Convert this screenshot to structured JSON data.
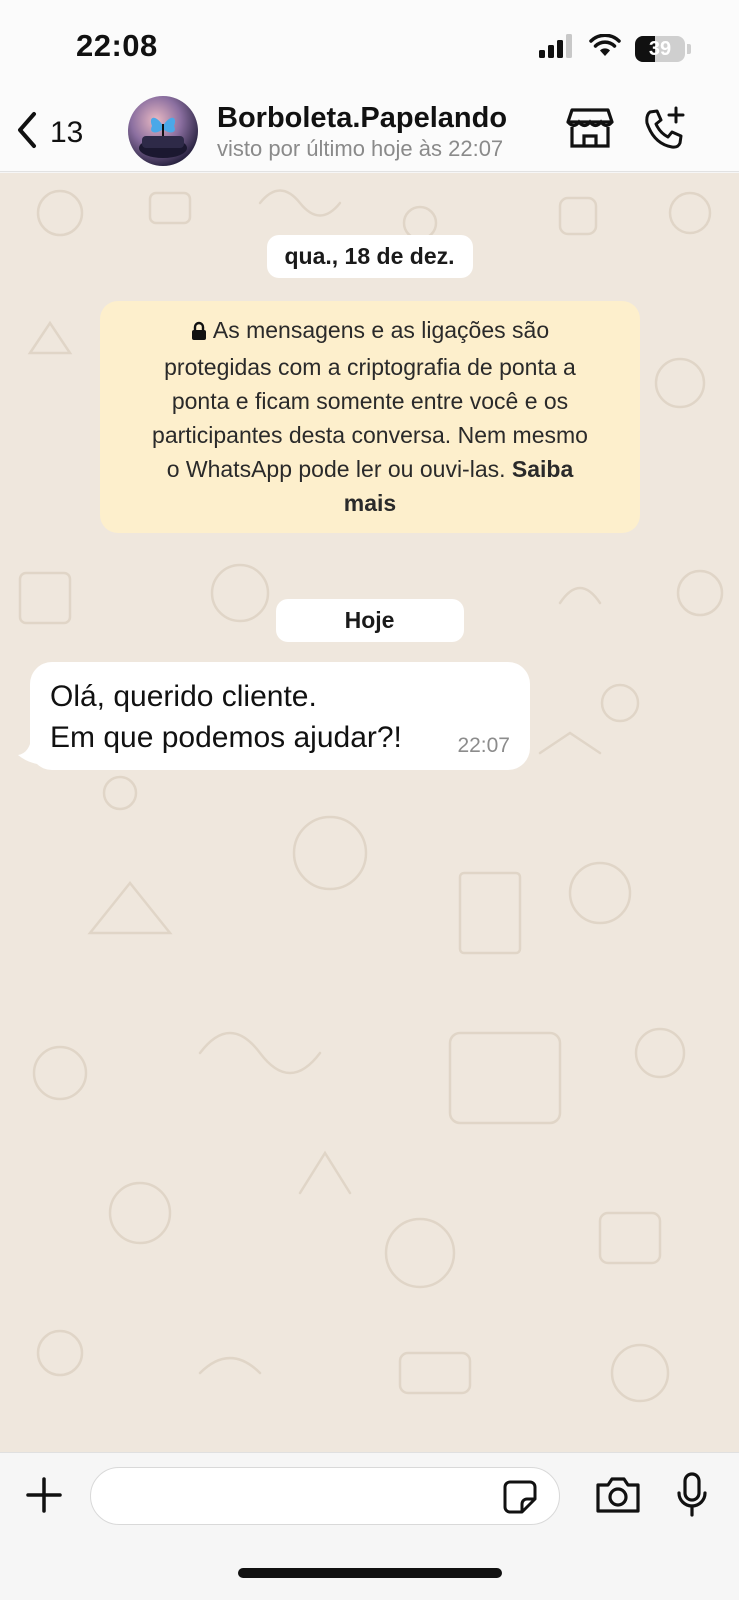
{
  "status_bar": {
    "time": "22:08",
    "battery": "39",
    "battery_level": 0.39
  },
  "header": {
    "back_count": "13",
    "contact_name": "Borboleta.Papelando",
    "last_seen": "visto por último hoje às 22:07",
    "icons": [
      "chevron-left-icon",
      "avatar",
      "store-icon",
      "phone-add-icon"
    ]
  },
  "chat": {
    "date_label": "qua., 18 de dez.",
    "encryption_notice": {
      "line1": "As mensagens e as ligações são",
      "line2": "protegidas com a criptografia de ponta a",
      "line3": "ponta e ficam somente entre você e os",
      "line4": "participantes desta conversa. Nem mesmo",
      "line5": "o WhatsApp pode ler ou ouvi-las.",
      "link": "Saiba",
      "link_cont": "mais"
    },
    "today_label": "Hoje",
    "messages": [
      {
        "lines": [
          "Olá, querido cliente.",
          "Em que podemos ajudar?!"
        ],
        "time": "22:07",
        "direction": "incoming"
      }
    ]
  },
  "input_bar": {
    "placeholder": "",
    "icons": [
      "plus-icon",
      "sticker-icon",
      "camera-icon",
      "microphone-icon"
    ]
  },
  "colors": {
    "chat_background": "#efe7dd",
    "notice_background": "#fdefcc",
    "bubble_incoming": "#ffffff",
    "secondary_text": "#8a8a8a"
  }
}
